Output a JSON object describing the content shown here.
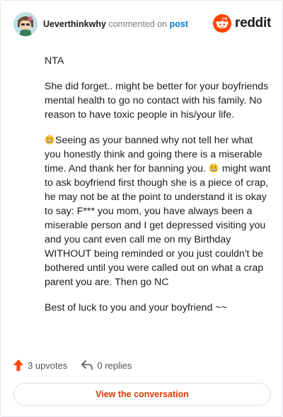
{
  "comment": {
    "username": "Ueverthinkwhy",
    "commented_text": "commented on",
    "post_link": "post"
  },
  "brand": {
    "name": "reddit",
    "color": "#ff4500"
  },
  "body": {
    "p1": "NTA",
    "p2": "She did forget.. might be better for your boyfriends mental health to go no contact with his family. No reason to have toxic people in his/your life.",
    "p3a": "Seeing as your banned why not tell her what you honestly think and going there is a miserable time. And thank her for banning you.",
    "p3b": "might want to ask boyfriend first though she is a piece of crap, he may not be at the point to understand it is okay to say: F*** you mom, you have always been a miserable person and I get depressed visiting you and you cant even call me on my Birthday WITHOUT being reminded or you just couldn't be bothered until you were called out on what a crap parent you are. Then go NC",
    "p4": "Best of luck to you and your boyfriend ~~"
  },
  "actions": {
    "upvotes": "3 upvotes",
    "replies": "0 replies",
    "upvote_color": "#ff4500"
  },
  "cta": {
    "label": "View the conversation",
    "color": "#d93a00"
  }
}
